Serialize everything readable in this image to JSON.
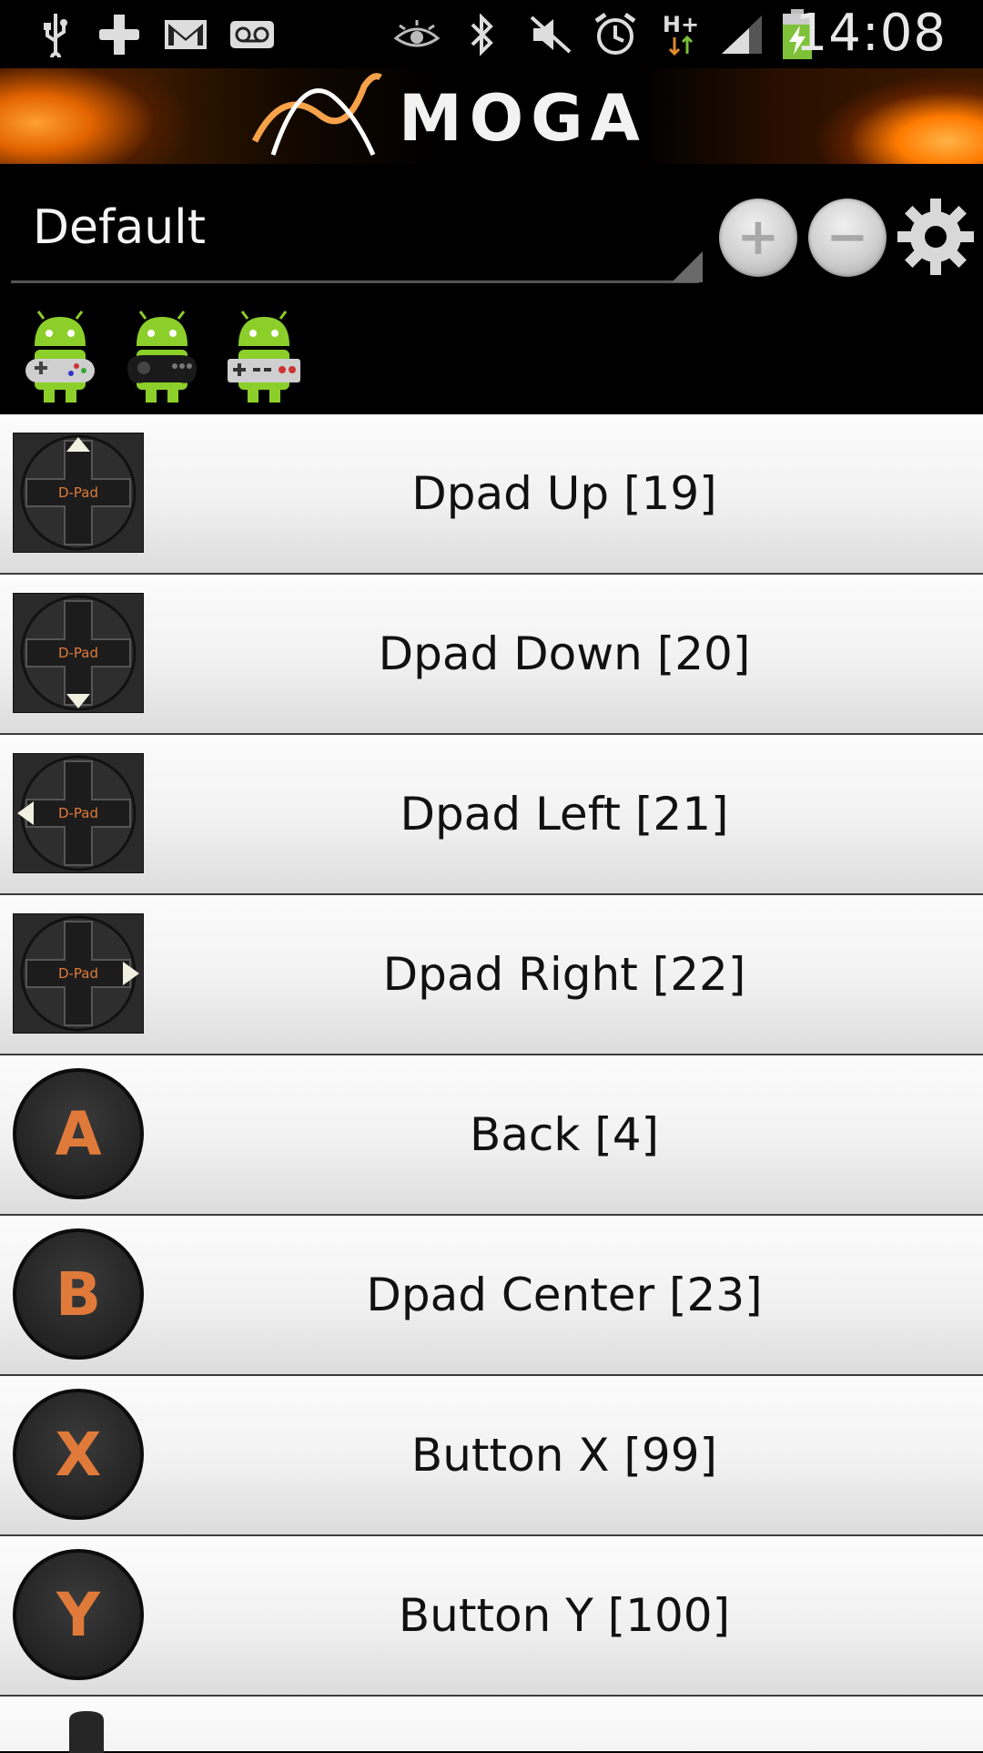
{
  "status_bar": {
    "time": "14:08",
    "network": "H+",
    "icons": [
      "usb-icon",
      "download-icon",
      "gmail-icon",
      "voicemail-icon",
      "eye-icon",
      "bluetooth-icon",
      "mute-icon",
      "alarm-icon",
      "signal-icon",
      "battery-charging-icon"
    ]
  },
  "banner": {
    "logo": "MOGA"
  },
  "profile": {
    "selected": "Default",
    "add_label": "+",
    "remove_label": "−"
  },
  "controllers": [
    "snes-controller-android-icon",
    "genesis-controller-android-icon",
    "nes-controller-android-icon"
  ],
  "dpad_text": "D-Pad",
  "mappings": [
    {
      "icon": "dpad-up",
      "glyph": "",
      "label": "Dpad Up [19]"
    },
    {
      "icon": "dpad-down",
      "glyph": "",
      "label": "Dpad Down [20]"
    },
    {
      "icon": "dpad-left",
      "glyph": "",
      "label": "Dpad Left [21]"
    },
    {
      "icon": "dpad-right",
      "glyph": "",
      "label": "Dpad Right [22]"
    },
    {
      "icon": "button-a",
      "glyph": "A",
      "label": "Back [4]"
    },
    {
      "icon": "button-b",
      "glyph": "B",
      "label": "Dpad Center [23]"
    },
    {
      "icon": "button-x",
      "glyph": "X",
      "label": "Button X [99]"
    },
    {
      "icon": "button-y",
      "glyph": "Y",
      "label": "Button Y [100]"
    }
  ],
  "colors": {
    "accent": "#e07a3a",
    "row_bg": "#f1f1f1"
  }
}
